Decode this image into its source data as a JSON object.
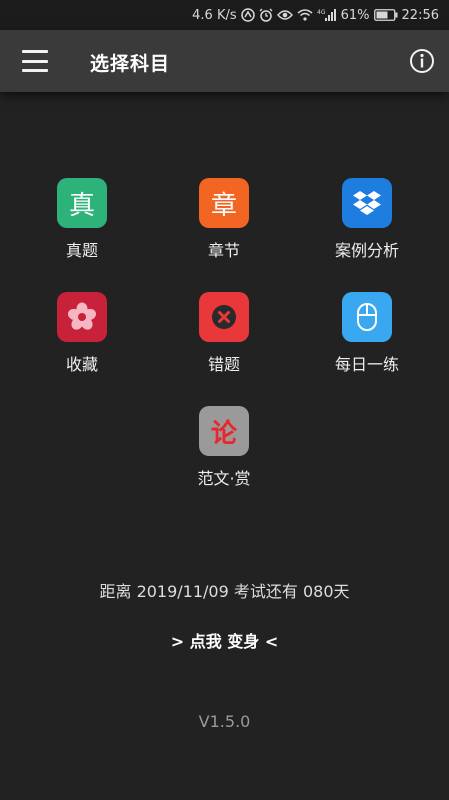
{
  "status_bar": {
    "speed": "4.6 K/s",
    "battery": "61%",
    "time": "22:56",
    "network_badge": "4G"
  },
  "app_bar": {
    "title": "选择科目"
  },
  "subjects": [
    {
      "label": "真题",
      "icon": "zhen-glyph-icon",
      "glyph": "真",
      "color": "#2db37a"
    },
    {
      "label": "章节",
      "icon": "zhang-glyph-icon",
      "glyph": "章",
      "color": "#f26522"
    },
    {
      "label": "案例分析",
      "icon": "dropbox-icon",
      "glyph": "",
      "color": "#1e7ee0"
    },
    {
      "label": "收藏",
      "icon": "flower-icon",
      "glyph": "",
      "color": "#c8213a"
    },
    {
      "label": "错题",
      "icon": "close-circle-icon",
      "glyph": "",
      "color": "#e8383c"
    },
    {
      "label": "每日一练",
      "icon": "mouse-icon",
      "glyph": "",
      "color": "#3aa8f0"
    },
    {
      "label": "范文·赏",
      "icon": "lun-glyph-icon",
      "glyph": "论",
      "color": "#9a9a9a"
    }
  ],
  "countdown_text": "距离 2019/11/09 考试还有 080天",
  "transform_text": "> 点我  变身 <",
  "version": "V1.5.0"
}
